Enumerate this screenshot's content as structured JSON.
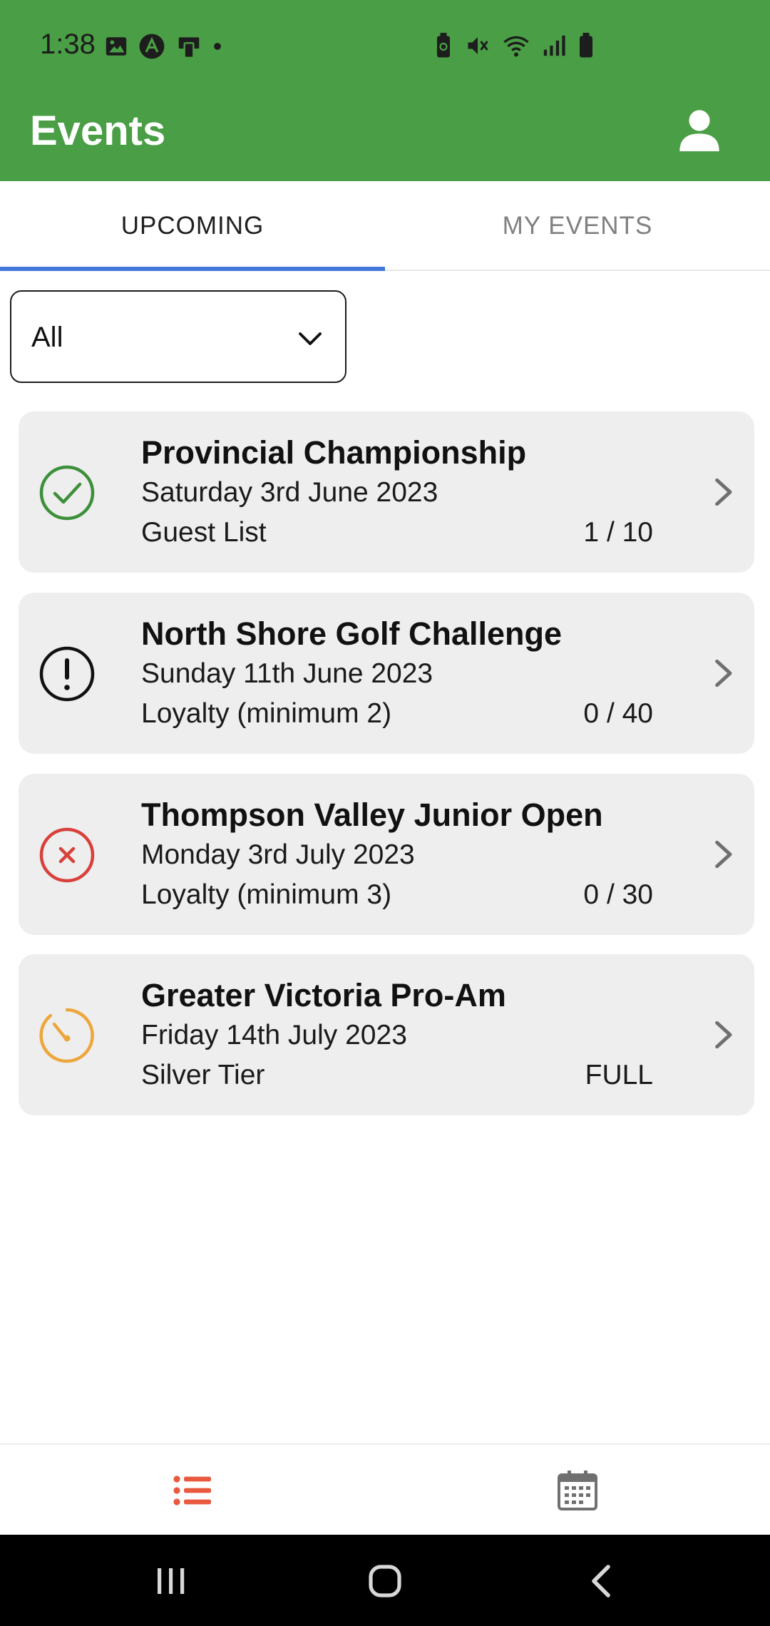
{
  "status_bar": {
    "time": "1:38"
  },
  "app_bar": {
    "title": "Events"
  },
  "tabs": [
    {
      "label": "UPCOMING",
      "active": true
    },
    {
      "label": "MY EVENTS",
      "active": false
    }
  ],
  "filter": {
    "value": "All"
  },
  "events": [
    {
      "name": "Provincial Championship",
      "date": "Saturday 3rd June 2023",
      "tier": "Guest List",
      "count": "1 / 10",
      "status_icon": "check-circle-icon"
    },
    {
      "name": "North Shore Golf Challenge",
      "date": "Sunday 11th June 2023",
      "tier": "Loyalty (minimum 2)",
      "count": "0 / 40",
      "status_icon": "alert-circle-icon"
    },
    {
      "name": "Thompson Valley Junior Open",
      "date": "Monday 3rd July 2023",
      "tier": "Loyalty (minimum 3)",
      "count": "0 / 30",
      "status_icon": "x-circle-icon"
    },
    {
      "name": "Greater Victoria Pro-Am",
      "date": "Friday 14th July 2023",
      "tier": "Silver Tier",
      "count": "FULL",
      "status_icon": "timer-icon"
    }
  ],
  "bottom_nav": [
    {
      "icon": "list-icon",
      "active": true
    },
    {
      "icon": "calendar-icon",
      "active": false
    }
  ],
  "colors": {
    "brand_green": "#4a9e45",
    "tab_indicator": "#4378d9",
    "check_green": "#3d8f3a",
    "error_red": "#d8403a",
    "warning_orange": "#eda63c",
    "list_active": "#e8593e",
    "card_bg": "#eeeeee"
  }
}
